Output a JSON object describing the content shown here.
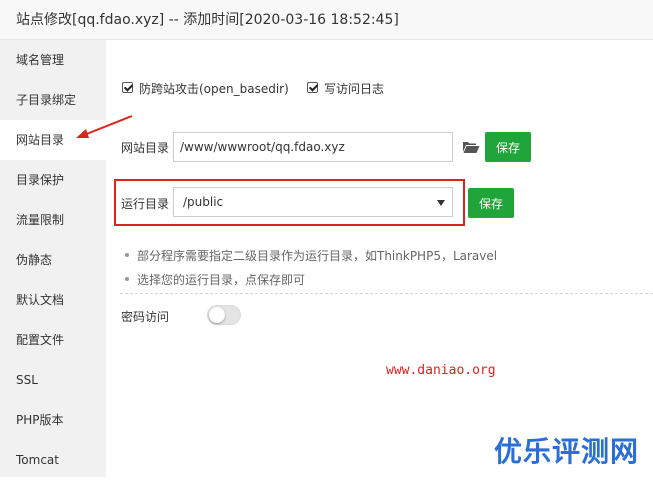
{
  "window": {
    "title": "站点修改[qq.fdao.xyz] -- 添加时间[2020-03-16 18:52:45]"
  },
  "sidebar": {
    "items": [
      {
        "label": "域名管理"
      },
      {
        "label": "子目录绑定"
      },
      {
        "label": "网站目录",
        "active": true
      },
      {
        "label": "目录保护"
      },
      {
        "label": "流量限制"
      },
      {
        "label": "伪静态"
      },
      {
        "label": "默认文档"
      },
      {
        "label": "配置文件"
      },
      {
        "label": "SSL"
      },
      {
        "label": "PHP版本"
      },
      {
        "label": "Tomcat"
      }
    ]
  },
  "options": {
    "open_basedir_label": "防跨站攻击(open_basedir)",
    "open_basedir_checked": true,
    "access_log_label": "写访问日志",
    "access_log_checked": true
  },
  "site_dir": {
    "label": "网站目录",
    "value": "/www/wwwroot/qq.fdao.xyz",
    "folder_icon": "folder-open-icon",
    "save_label": "保存"
  },
  "run_dir": {
    "label": "运行目录",
    "selected": "/public",
    "save_label": "保存"
  },
  "tips": [
    "部分程序需要指定二级目录作为运行目录，如ThinkPHP5，Laravel",
    "选择您的运行目录，点保存即可"
  ],
  "password_access": {
    "label": "密码访问",
    "enabled": false
  },
  "watermark": {
    "url": "www.daniao.org",
    "logo": "优乐评测网"
  },
  "colors": {
    "accent": "#20a53a",
    "highlight": "#d9261c",
    "watermark_url": "#e0201a",
    "watermark_logo": "#2a6fd6"
  }
}
